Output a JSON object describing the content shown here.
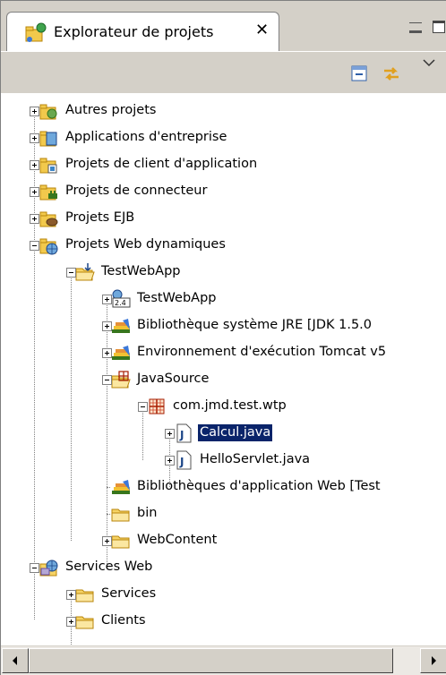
{
  "view": {
    "title": "Explorateur de projets",
    "close_glyph": "✕"
  },
  "tree": [
    {
      "label": "Autres projets",
      "icon": "other-projects-icon"
    },
    {
      "label": "Applications d'entreprise",
      "icon": "enterprise-app-icon"
    },
    {
      "label": "Projets de client d'application",
      "icon": "app-client-icon"
    },
    {
      "label": "Projets de connecteur",
      "icon": "connector-icon"
    },
    {
      "label": "Projets EJB",
      "icon": "ejb-icon"
    },
    {
      "label": "Projets Web dynamiques",
      "icon": "web-project-icon"
    },
    {
      "label": "TestWebApp",
      "icon": "project-folder-icon"
    },
    {
      "label": "TestWebApp",
      "icon": "deployment-descriptor-icon",
      "badge": "2.4"
    },
    {
      "label": "Bibliothèque système JRE [JDK 1.5.0",
      "icon": "library-icon"
    },
    {
      "label": "Environnement d'exécution Tomcat v5",
      "icon": "library-icon"
    },
    {
      "label": "JavaSource",
      "icon": "source-folder-icon"
    },
    {
      "label": "com.jmd.test.wtp",
      "icon": "package-icon"
    },
    {
      "label": "Calcul.java",
      "icon": "java-file-icon"
    },
    {
      "label": "HelloServlet.java",
      "icon": "java-file-icon"
    },
    {
      "label": "Bibliothèques d'application Web [Test",
      "icon": "library-icon"
    },
    {
      "label": "bin",
      "icon": "folder-icon"
    },
    {
      "label": "WebContent",
      "icon": "folder-icon"
    },
    {
      "label": "Services Web",
      "icon": "web-services-icon"
    },
    {
      "label": "Services",
      "icon": "folder-icon"
    },
    {
      "label": "Clients",
      "icon": "folder-icon"
    }
  ],
  "colors": {
    "selection": "#0a246a",
    "chrome": "#d4d0c8"
  }
}
